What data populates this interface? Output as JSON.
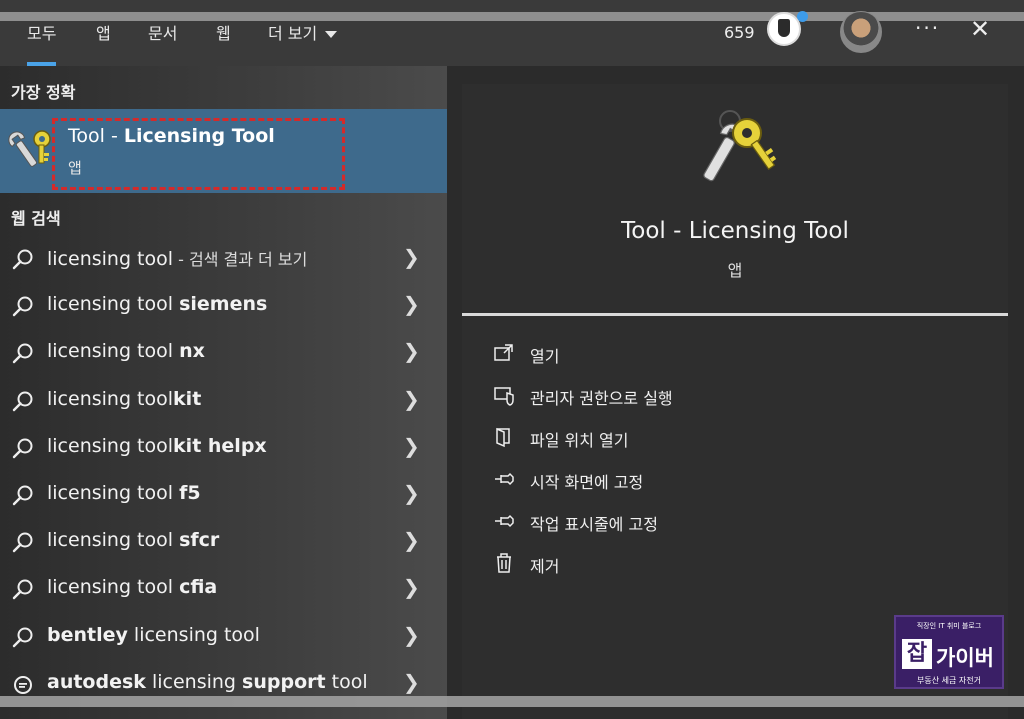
{
  "tabs": [
    "모두",
    "앱",
    "문서",
    "웹",
    "더 보기"
  ],
  "header": {
    "points": "659",
    "more_label": "···",
    "close_label": "✕"
  },
  "best_match": {
    "section_label": "가장 정확",
    "title_prefix": "Tool - ",
    "title_bold": "Licensing Tool",
    "subtitle": "앱"
  },
  "web_search": {
    "section_label": "웹 검색",
    "results": [
      {
        "pre": "licensing tool",
        "bold": "",
        "post": "",
        "suffix": " - 검색 결과 더 보기"
      },
      {
        "pre": "licensing tool ",
        "bold": "siemens",
        "post": "",
        "suffix": ""
      },
      {
        "pre": "licensing tool ",
        "bold": "nx",
        "post": "",
        "suffix": ""
      },
      {
        "pre": "licensing tool",
        "bold": "kit",
        "post": "",
        "suffix": ""
      },
      {
        "pre": "licensing tool",
        "bold": "kit helpx",
        "post": "",
        "suffix": ""
      },
      {
        "pre": "licensing tool ",
        "bold": "f5",
        "post": "",
        "suffix": ""
      },
      {
        "pre": "licensing tool ",
        "bold": "sfcr",
        "post": "",
        "suffix": ""
      },
      {
        "pre": "licensing tool ",
        "bold": "cfia",
        "post": "",
        "suffix": ""
      },
      {
        "pre": "",
        "bold": "bentley",
        "post": " licensing tool",
        "suffix": ""
      },
      {
        "pre": "",
        "bold": "autodesk",
        "post": " licensing ",
        "bold2": "support",
        "post2": " tool",
        "suffix": ""
      }
    ]
  },
  "preview": {
    "title": "Tool - Licensing Tool",
    "subtitle": "앱"
  },
  "actions": [
    {
      "label": "열기",
      "icon": "open-icon"
    },
    {
      "label": "관리자 권한으로 실행",
      "icon": "shield-icon"
    },
    {
      "label": "파일 위치 열기",
      "icon": "folder-icon"
    },
    {
      "label": "시작 화면에 고정",
      "icon": "pin-icon"
    },
    {
      "label": "작업 표시줄에 고정",
      "icon": "pin-icon"
    },
    {
      "label": "제거",
      "icon": "trash-icon"
    }
  ],
  "watermark": {
    "top": "직장인 IT 취미 블로그",
    "badge": "잡",
    "name": "가이버",
    "bottom": "부동산 세금 자전거"
  },
  "colors": {
    "accent": "#4aa3e8",
    "selected_row": "#3e6a8c",
    "highlight_box": "#d42a2a"
  }
}
